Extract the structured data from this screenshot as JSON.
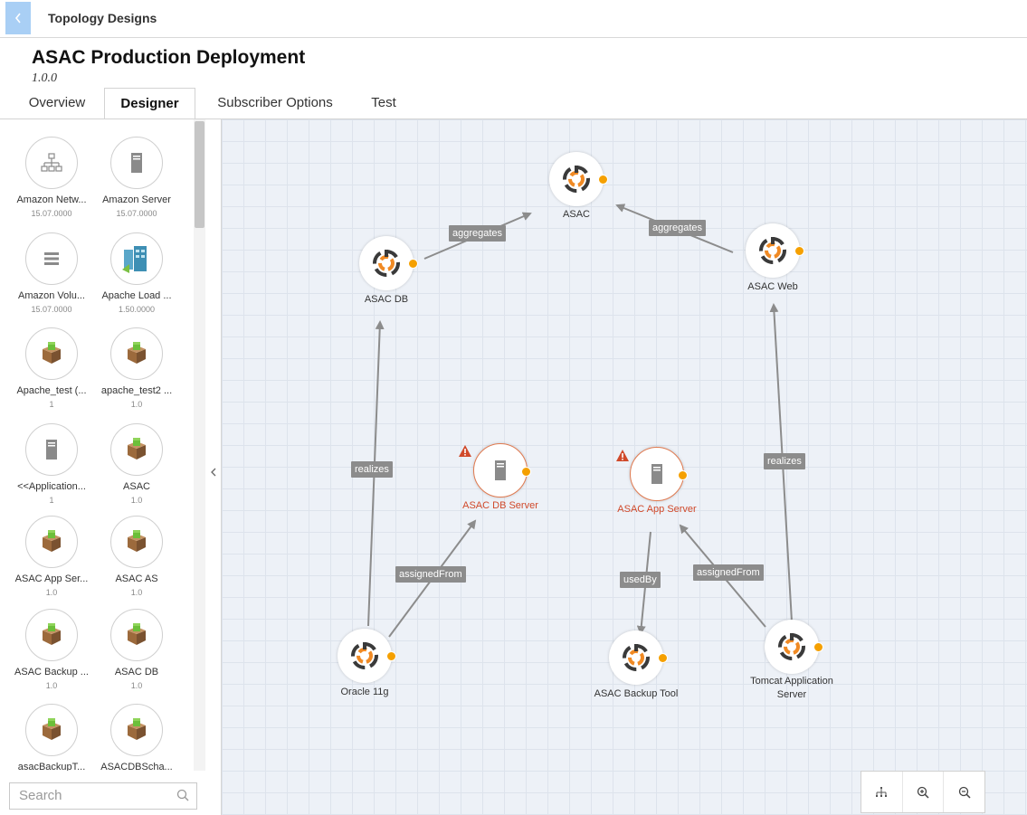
{
  "header": {
    "breadcrumb": "Topology Designs",
    "title": "ASAC Production Deployment",
    "version": "1.0.0"
  },
  "tabs": [
    {
      "label": "Overview"
    },
    {
      "label": "Designer",
      "active": true
    },
    {
      "label": "Subscriber Options"
    },
    {
      "label": "Test"
    }
  ],
  "palette": {
    "items": [
      {
        "name": "Amazon Netw...",
        "version": "15.07.0000",
        "icon": "network-icon"
      },
      {
        "name": "Amazon Server",
        "version": "15.07.0000",
        "icon": "server-icon"
      },
      {
        "name": "Amazon Volu...",
        "version": "15.07.0000",
        "icon": "volume-icon"
      },
      {
        "name": "Apache Load ...",
        "version": "1.50.0000",
        "icon": "load-balancer-icon"
      },
      {
        "name": "Apache_test (...",
        "version": "1",
        "icon": "package-icon"
      },
      {
        "name": "apache_test2 ...",
        "version": "1.0",
        "icon": "package-icon"
      },
      {
        "name": "<<Application...",
        "version": "1",
        "icon": "server-icon"
      },
      {
        "name": "ASAC",
        "version": "1.0",
        "icon": "package-icon"
      },
      {
        "name": "ASAC App Ser...",
        "version": "1.0",
        "icon": "package-icon"
      },
      {
        "name": "ASAC AS",
        "version": "1.0",
        "icon": "package-icon"
      },
      {
        "name": "ASAC Backup ...",
        "version": "1.0",
        "icon": "package-icon"
      },
      {
        "name": "ASAC DB",
        "version": "1.0",
        "icon": "package-icon"
      },
      {
        "name": "asacBackupT...",
        "version": "",
        "icon": "package-icon"
      },
      {
        "name": "ASACDBScha...",
        "version": "",
        "icon": "package-icon"
      }
    ],
    "search_placeholder": "Search"
  },
  "canvas": {
    "nodes": [
      {
        "id": "asac",
        "label": "ASAC",
        "icon": "component-icon"
      },
      {
        "id": "asac-db",
        "label": "ASAC DB",
        "icon": "component-icon"
      },
      {
        "id": "asac-web",
        "label": "ASAC Web",
        "icon": "component-icon"
      },
      {
        "id": "asac-db-server",
        "label": "ASAC DB Server",
        "icon": "server-icon",
        "warning": true
      },
      {
        "id": "asac-app-server",
        "label": "ASAC App Server",
        "icon": "server-icon",
        "warning": true
      },
      {
        "id": "oracle",
        "label": "Oracle 11g",
        "icon": "component-icon"
      },
      {
        "id": "backup-tool",
        "label": "ASAC Backup Tool",
        "icon": "component-icon"
      },
      {
        "id": "tomcat",
        "label": "Tomcat Application Server",
        "icon": "component-icon"
      }
    ],
    "edges": [
      {
        "from": "asac-db",
        "to": "asac",
        "label": "aggregates"
      },
      {
        "from": "asac-web",
        "to": "asac",
        "label": "aggregates"
      },
      {
        "from": "oracle",
        "to": "asac-db",
        "label": "realizes"
      },
      {
        "from": "tomcat",
        "to": "asac-web",
        "label": "realizes"
      },
      {
        "from": "oracle",
        "to": "asac-db-server",
        "label": "assignedFrom"
      },
      {
        "from": "asac-app-server",
        "to": "backup-tool",
        "label": "usedBy"
      },
      {
        "from": "tomcat",
        "to": "asac-app-server",
        "label": "assignedFrom"
      }
    ]
  },
  "colors": {
    "accent_port": "#f5a000",
    "warning": "#d0492a",
    "canvas_bg": "#edf1f7"
  }
}
